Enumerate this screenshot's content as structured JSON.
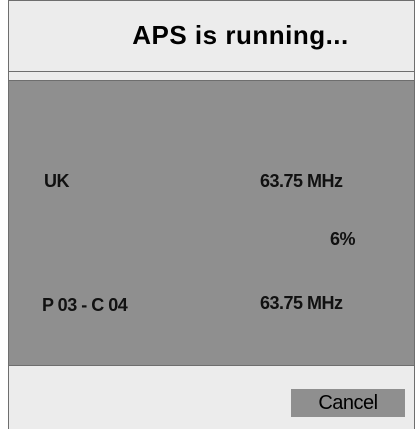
{
  "dialog": {
    "title": "APS is running..."
  },
  "status": {
    "country": "UK",
    "frequency": "63.75 MHz",
    "progress_text": "6%",
    "progress": 0.06,
    "channel": "P 03 - C 04",
    "channel_frequency": "63.75 MHz"
  },
  "footer": {
    "cancel_label": "Cancel"
  },
  "colors": {
    "panel_gray": "#8f8f8f",
    "header_bg": "#ececec",
    "border": "#6e6e6e"
  }
}
